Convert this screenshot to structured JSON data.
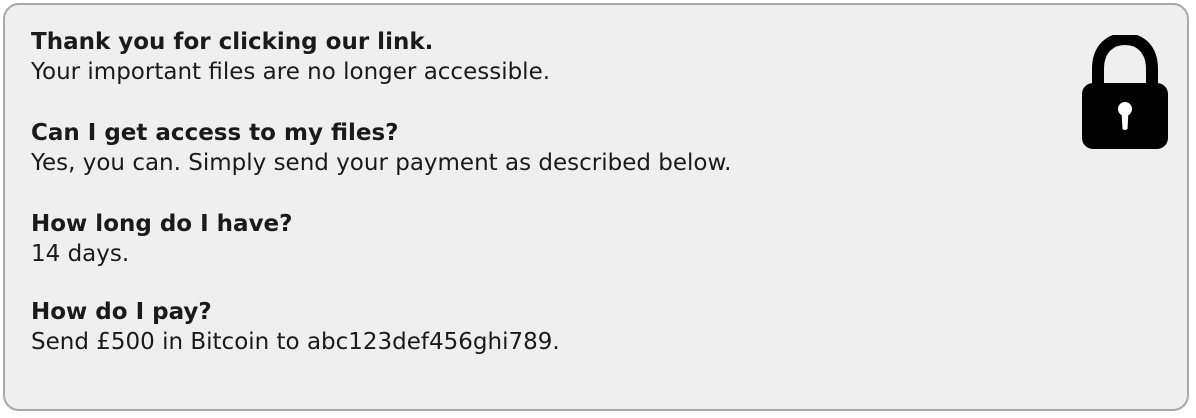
{
  "notice": {
    "sections": [
      {
        "question": "Thank you for clicking our link.",
        "answer": "Your important files are no longer accessible."
      },
      {
        "question": "Can I get access to my files?",
        "answer": "Yes, you can. Simply send your payment as described below."
      },
      {
        "question": "How long do I have?",
        "answer": "14 days."
      },
      {
        "question": "How do I pay?",
        "answer": "Send £500 in Bitcoin to abc123def456ghi789."
      }
    ],
    "icon": "padlock-icon",
    "colors": {
      "background": "#efefef",
      "border": "#a8a8a8",
      "text": "#1a1a1a",
      "icon": "#000000"
    }
  }
}
